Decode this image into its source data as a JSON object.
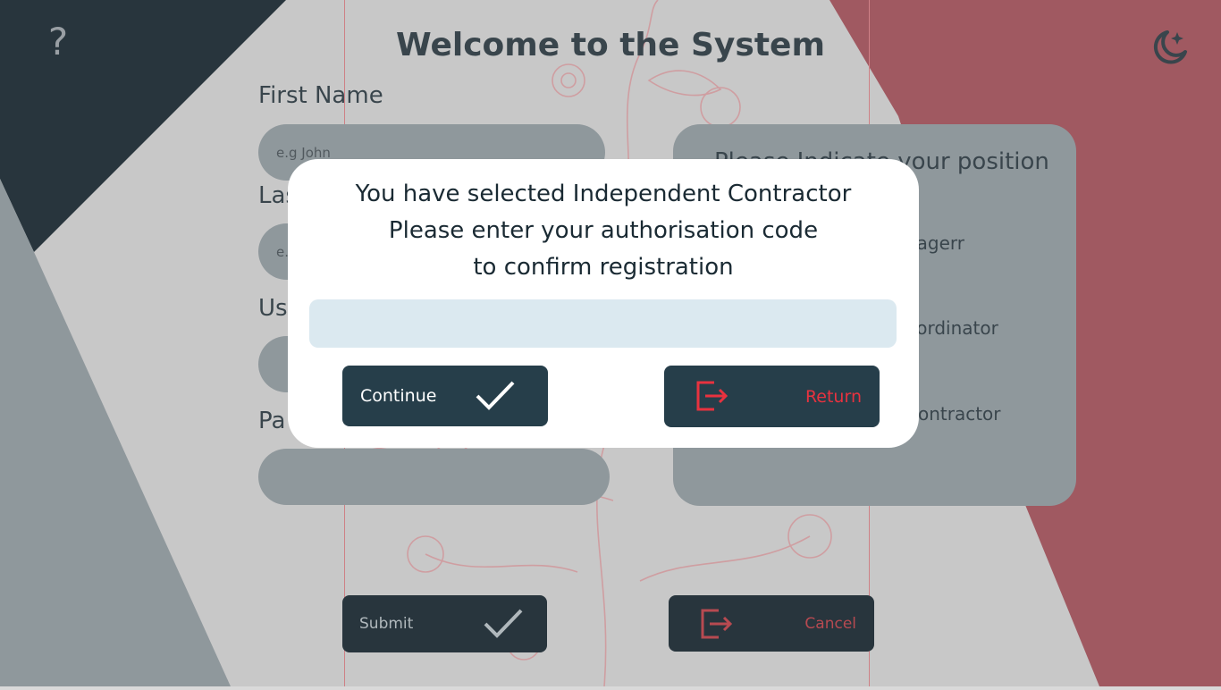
{
  "header": {
    "title": "Welcome to the System",
    "help_label": "?"
  },
  "form": {
    "first_name": {
      "label": "First Name",
      "placeholder": "e.g John"
    },
    "last_name": {
      "label": "Las",
      "placeholder": "e."
    },
    "username": {
      "label": "Us"
    },
    "password": {
      "label": "Pa"
    }
  },
  "position_panel": {
    "title": "Please Indicate your position itting",
    "options": [
      "nagerr",
      "oordinator",
      "Contractor"
    ]
  },
  "actions": {
    "submit_label": "Submit",
    "cancel_label": "Cancel"
  },
  "modal": {
    "line1": "You have selected Independent Contractor",
    "line2": "Please enter your authorisation code",
    "line3": "to confirm registration",
    "code_value": "",
    "continue_label": "Continue",
    "return_label": "Return"
  },
  "colors": {
    "dark_navy": "#03141f",
    "brand_red": "#a3444f",
    "slate": "#8d989e",
    "accent_red": "#e8323f",
    "modal_button": "#263e4a"
  },
  "icons": [
    "help-icon",
    "theme-toggle-icon",
    "checkmark-icon",
    "exit-icon"
  ]
}
